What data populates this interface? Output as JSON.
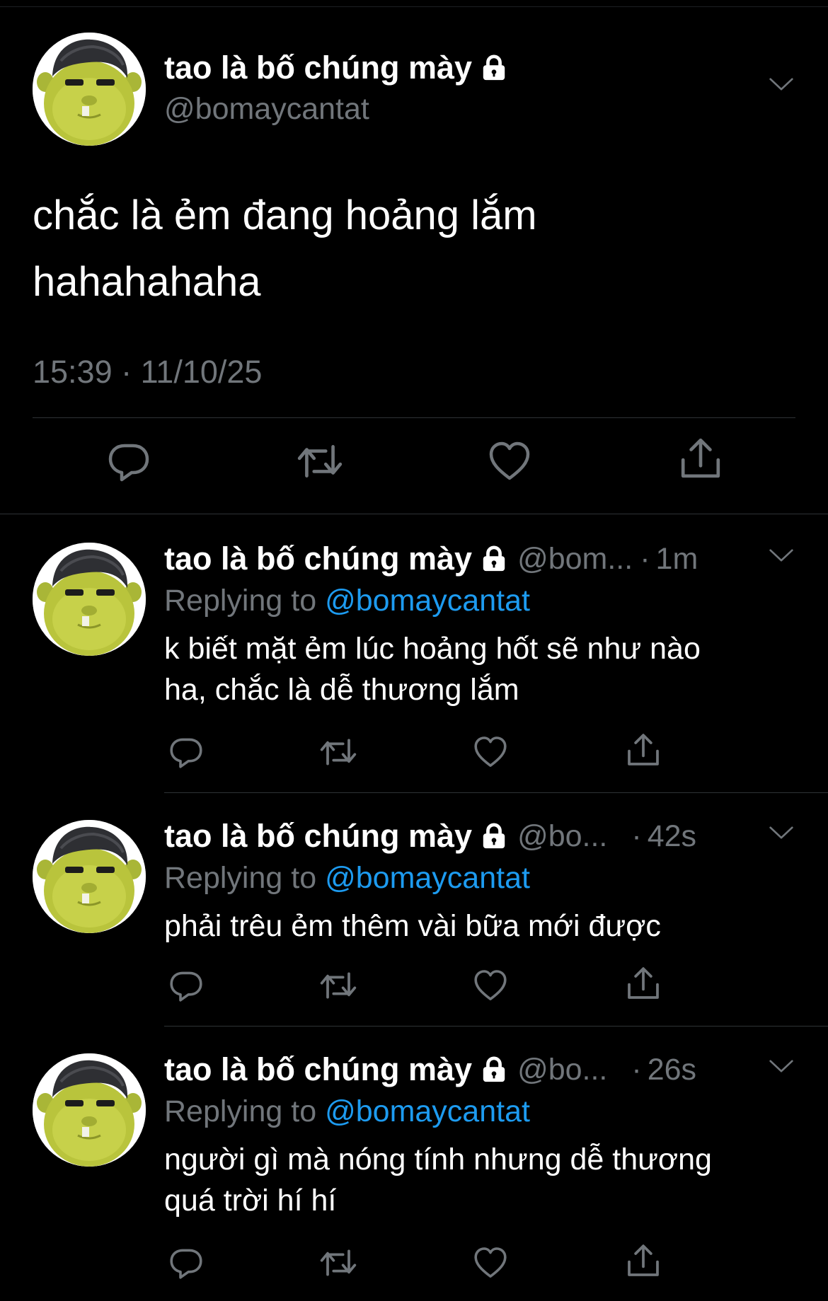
{
  "user": {
    "display_name": "tao là bố chúng mày",
    "handle": "@bomaycantat",
    "avatar_icon": "shrek-face-avatar",
    "locked_icon": "lock-icon"
  },
  "main_tweet": {
    "text_lines": [
      "chắc là ẻm đang hoảng lắm",
      "hahahahaha"
    ],
    "timestamp": "15:39 · 11/10/25"
  },
  "actions": {
    "reply_icon": "reply-bubble-icon",
    "retweet_icon": "retweet-icon",
    "like_icon": "heart-icon",
    "share_icon": "share-icon",
    "more_icon": "chevron-down-icon"
  },
  "colors": {
    "background": "#000000",
    "text": "#ffffff",
    "muted": "#71767b",
    "link": "#1d9bf0",
    "divider": "#2f3336"
  },
  "replies": [
    {
      "display_name": "tao là bố chúng mày",
      "handle_truncated": "@bom...",
      "dot": "·",
      "age": "1m",
      "replying_prefix": "Replying to",
      "replying_to": "@bomaycantat",
      "text_lines": [
        "k biết mặt ẻm lúc hoảng hốt sẽ như nào",
        "ha, chắc là dễ thương lắm"
      ]
    },
    {
      "display_name": "tao là bố chúng mày",
      "handle_truncated": "@bo...",
      "dot": "·",
      "age": "42s",
      "replying_prefix": "Replying to",
      "replying_to": "@bomaycantat",
      "text_lines": [
        "phải trêu ẻm thêm vài bữa mới được"
      ]
    },
    {
      "display_name": "tao là bố chúng mày",
      "handle_truncated": "@bo...",
      "dot": "·",
      "age": "26s",
      "replying_prefix": "Replying to",
      "replying_to": "@bomaycantat",
      "text_lines": [
        "người gì mà nóng tính nhưng dễ thương",
        "quá trời hí hí"
      ]
    }
  ]
}
